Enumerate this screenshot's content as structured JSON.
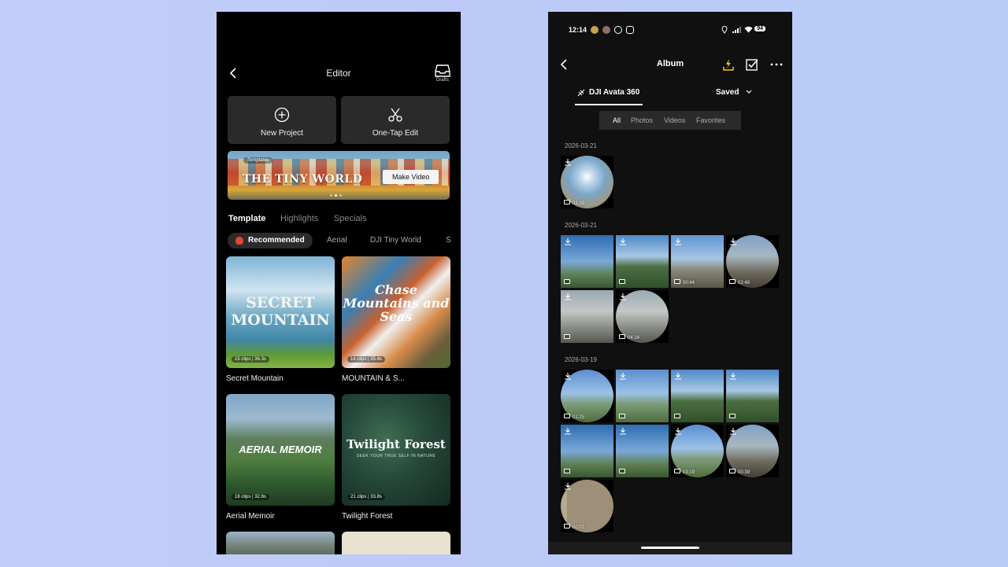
{
  "editor": {
    "title": "Editor",
    "drafts_label": "Drafts",
    "new_project_label": "New Project",
    "one_tap_label": "One-Tap Edit",
    "banner": {
      "tag": "Templates",
      "title": "THE TINY WORLD",
      "button": "Make Video"
    },
    "tabs": [
      "Template",
      "Highlights",
      "Specials"
    ],
    "chips": [
      "Recommended",
      "Aerial",
      "DJI Tiny World",
      "S"
    ],
    "tiles": [
      {
        "overlay": "SECRET MOUNTAIN",
        "meta": "15 clips | 36.3s",
        "name": "Secret Mountain"
      },
      {
        "overlay": "Chase Mountains and Seas",
        "meta": "14 clips | 35.4s",
        "name": "MOUNTAIN & S..."
      },
      {
        "overlay": "AERIAL MEMOIR",
        "meta": "18 clips | 32.6s",
        "name": "Aerial Memoir"
      },
      {
        "overlay": "Twilight Forest",
        "subtitle": "SEEK YOUR TRUE SELF IN NATURE",
        "meta": "21 clips | 33.8s",
        "name": "Twilight Forest"
      }
    ]
  },
  "album": {
    "status": {
      "time": "12:14",
      "battery": "94"
    },
    "title": "Album",
    "device_tab": "DJI Avata 360",
    "saved_label": "Saved",
    "filters": [
      "All",
      "Photos",
      "Videos",
      "Favorites"
    ],
    "groups": [
      {
        "date": "2026-03-21",
        "durations": [
          "03:38"
        ]
      },
      {
        "date": "2026-03-21",
        "durations": [
          "",
          "",
          "00:44",
          "02:48",
          "",
          "04:24"
        ]
      },
      {
        "date": "2026-03-19",
        "durations": [
          "01:25",
          "",
          "",
          "",
          "",
          "",
          "03:19",
          "00:39",
          "00:07"
        ]
      }
    ],
    "accent_color": "#f5c518"
  }
}
